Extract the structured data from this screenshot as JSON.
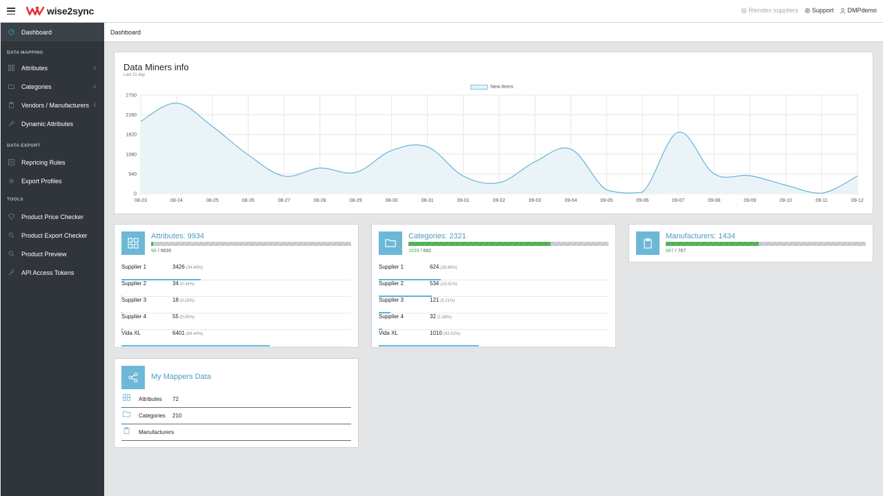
{
  "header": {
    "brand": "wise2sync",
    "links": [
      {
        "label": "Reindex suppliers",
        "icon": "layers-icon"
      },
      {
        "label": "Support",
        "icon": "gear-icon"
      },
      {
        "label": "DMPdemo",
        "icon": "user-icon"
      }
    ]
  },
  "sidebar": {
    "dashboard": "Dashboard",
    "section_mapping": "DATA MAPPING",
    "attributes": "Attributes",
    "categories": "Categories",
    "vendors": "Vendors / Manufacturers",
    "dynamic": "Dynamic Attributes",
    "section_export": "DATA EXPORT",
    "repricing": "Repricing Rules",
    "export_profiles": "Export Profiles",
    "section_tools": "TOOLS",
    "price_checker": "Product Price Checker",
    "export_checker": "Product Export Checker",
    "preview": "Product Preview",
    "api_tokens": "API Access Tokens"
  },
  "breadcrumb": "Dashboard",
  "chart_card": {
    "title": "Data Miners info",
    "subtitle": "Last 21 day",
    "legend": "New Items"
  },
  "chart_data": {
    "type": "area",
    "x": [
      "08-23",
      "08-24",
      "08-25",
      "08-26",
      "08-27",
      "08-28",
      "08-29",
      "08-30",
      "08-31",
      "09-01",
      "09-02",
      "09-03",
      "09-04",
      "09-05",
      "09-06",
      "09-07",
      "09-08",
      "09-09",
      "09-10",
      "09-11",
      "09-12"
    ],
    "series": [
      {
        "name": "New Items",
        "values": [
          1980,
          2480,
          1840,
          1060,
          480,
          700,
          580,
          1180,
          1280,
          480,
          300,
          870,
          1220,
          100,
          40,
          1680,
          540,
          490,
          230,
          10,
          480
        ]
      }
    ],
    "yticks": [
      0,
      540,
      1080,
      1620,
      2160,
      2700
    ],
    "ylim": [
      0,
      2700
    ],
    "grid": true,
    "legend_position": "top-center",
    "color": "#6cb8d6",
    "fill": "#eaf4f8"
  },
  "attributes_card": {
    "title": "Attributes: 9934",
    "done": "98",
    "total": "9836",
    "progress": 0.01,
    "rows": [
      {
        "name": "Supplier 1",
        "value": "3426",
        "pct": "(34.49%)",
        "ratio": 0.3449
      },
      {
        "name": "Supplier 2",
        "value": "34",
        "pct": "(0.34%)",
        "ratio": 0.0034
      },
      {
        "name": "Supplier 3",
        "value": "18",
        "pct": "(0.18%)",
        "ratio": 0.0018
      },
      {
        "name": "Supplier 4",
        "value": "55",
        "pct": "(0.55%)",
        "ratio": 0.0055
      },
      {
        "name": "Vida XL",
        "value": "6401",
        "pct": "(64.44%)",
        "ratio": 0.6444
      }
    ]
  },
  "categories_card": {
    "title": "Categories: 2321",
    "done": "1639",
    "total": "682",
    "progress": 0.71,
    "rows": [
      {
        "name": "Supplier 1",
        "value": "624",
        "pct": "(26.88%)",
        "ratio": 0.2688
      },
      {
        "name": "Supplier 2",
        "value": "534",
        "pct": "(23.01%)",
        "ratio": 0.2301
      },
      {
        "name": "Supplier 3",
        "value": "121",
        "pct": "(5.21%)",
        "ratio": 0.0521
      },
      {
        "name": "Supplier 4",
        "value": "32",
        "pct": "(1.38%)",
        "ratio": 0.0138
      },
      {
        "name": "Vida XL",
        "value": "1010",
        "pct": "(43.52%)",
        "ratio": 0.4352
      }
    ]
  },
  "manufacturers_card": {
    "title": "Manufacturers: 1434",
    "done": "667",
    "total": "767",
    "progress": 0.465
  },
  "mappers_card": {
    "title": "My Mappers Data",
    "rows": [
      {
        "label": "Attributes",
        "value": "72"
      },
      {
        "label": "Categories",
        "value": "210"
      },
      {
        "label": "Manufacturers",
        "value": ""
      }
    ]
  }
}
